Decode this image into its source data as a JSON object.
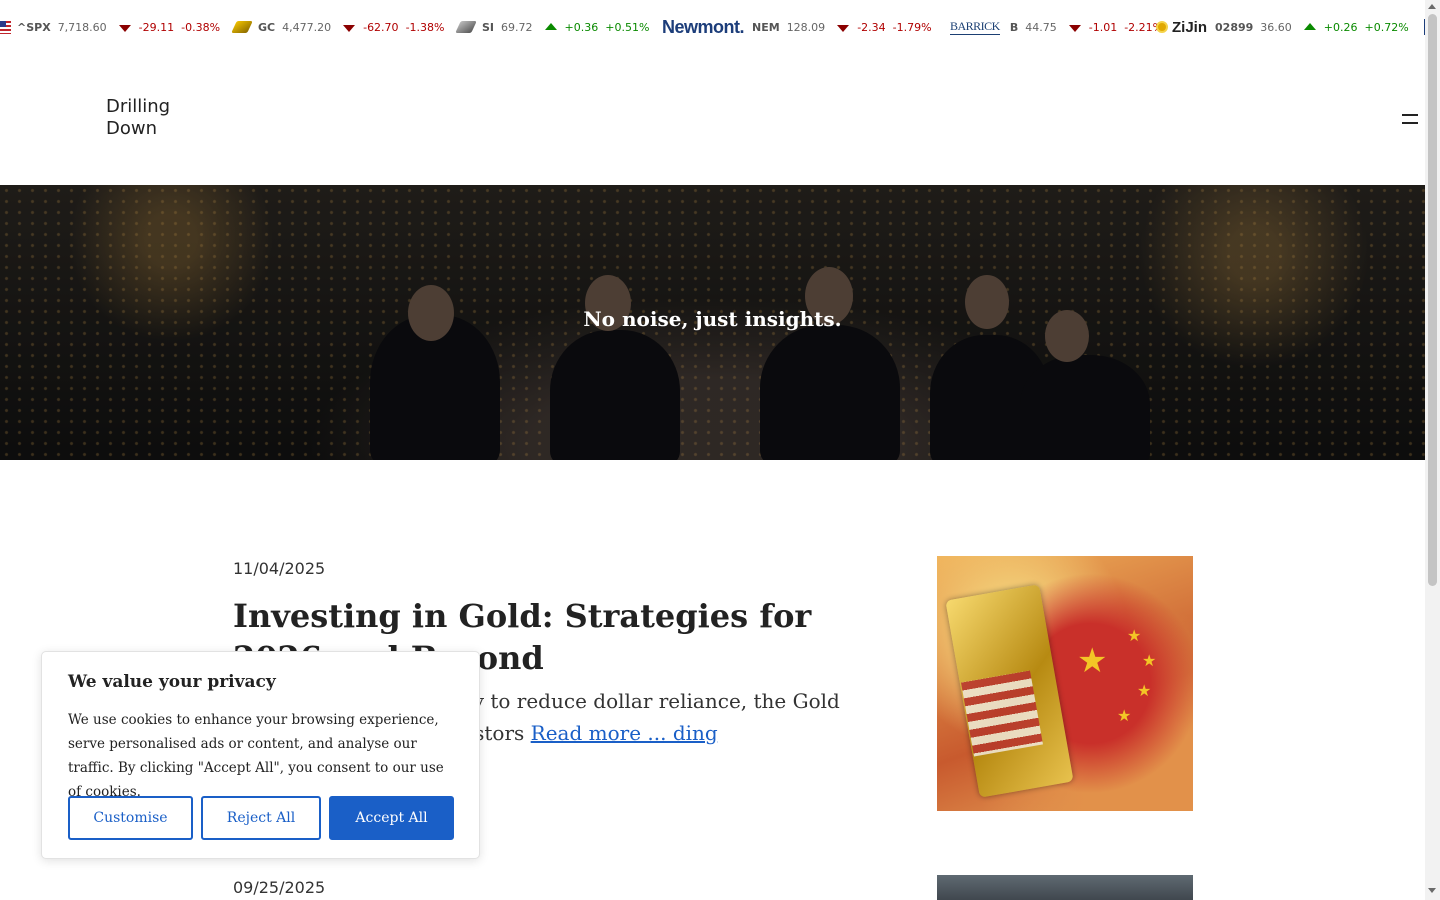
{
  "ticker": [
    {
      "symbol": "^SPX",
      "price": "7,718.60",
      "change": "-29.11",
      "percent": "-0.38%",
      "direction": "down",
      "logo": "us-flag-icon"
    },
    {
      "symbol": "GC",
      "price": "4,477.20",
      "change": "-62.70",
      "percent": "-1.38%",
      "direction": "down",
      "logo": "gold-bar-icon"
    },
    {
      "symbol": "SI",
      "price": "69.72",
      "change": "+0.36",
      "percent": "+0.51%",
      "direction": "up",
      "logo": "silver-bar-icon"
    },
    {
      "symbol": "NEM",
      "price": "128.09",
      "change": "-2.34",
      "percent": "-1.79%",
      "direction": "down",
      "logo_text": "Newmont."
    },
    {
      "symbol": "B",
      "price": "44.75",
      "change": "-1.01",
      "percent": "-2.21%",
      "direction": "down",
      "logo_text": "BARRICK"
    },
    {
      "symbol": "02899",
      "price": "36.60",
      "change": "+0.26",
      "percent": "+0.72%",
      "direction": "up",
      "logo_text": "ZiJin"
    }
  ],
  "colors": {
    "down": "#b00000",
    "up": "#0a8a00",
    "accent": "#1a5fc7"
  },
  "header": {
    "brand_line1": "Drilling",
    "brand_line2": "Down",
    "menu_icon": "hamburger-menu-icon"
  },
  "hero": {
    "tagline": "No noise, just insights."
  },
  "articles": [
    {
      "date": "11/04/2025",
      "title": "Investing in Gold: Strategies for 2026 and Beyond",
      "excerpt": "Explore China’s strategy to reduce dollar reliance, the Gold Corridor, and ways investors",
      "read_more": "Read more ... ding"
    },
    {
      "date": "09/25/2025"
    }
  ],
  "cookie": {
    "title": "We value your privacy",
    "text": "We use cookies to enhance your browsing experience, serve personalised ads or content, and analyse our traffic. By clicking \"Accept All\", you consent to our use of cookies.",
    "customise": "Customise",
    "reject": "Reject All",
    "accept": "Accept All"
  }
}
